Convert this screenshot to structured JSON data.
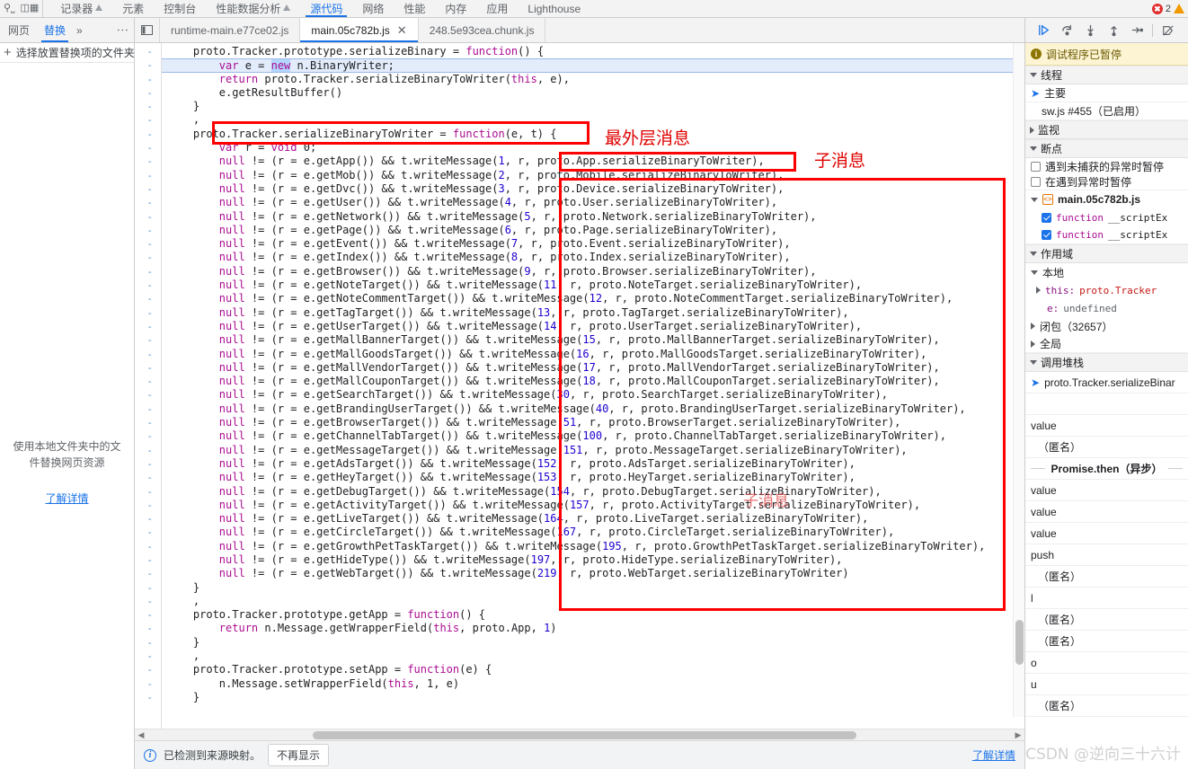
{
  "topbar": {
    "left_icons": [
      "cursor-select-icon",
      "device-toolbar-icon"
    ],
    "recorder_tab": "记录器",
    "panel_tabs": [
      {
        "label": "元素",
        "active": false,
        "warn": false
      },
      {
        "label": "控制台",
        "active": false,
        "warn": false
      },
      {
        "label": "性能数据分析",
        "active": false,
        "warn": true
      },
      {
        "label": "源代码",
        "active": true,
        "warn": false
      },
      {
        "label": "网络",
        "active": false,
        "warn": false
      },
      {
        "label": "性能",
        "active": false,
        "warn": false
      },
      {
        "label": "内存",
        "active": false,
        "warn": false
      },
      {
        "label": "应用",
        "active": false,
        "warn": false
      },
      {
        "label": "Lighthouse",
        "active": false,
        "warn": false
      }
    ],
    "error_count": "2"
  },
  "navigator": {
    "tabs": [
      {
        "label": "网页",
        "active": false
      },
      {
        "label": "替换",
        "active": true
      }
    ],
    "more_label": "»",
    "add_folder_label": "选择放置替换项的文件夹",
    "empty_message": "使用本地文件夹中的文件替换网页资源",
    "learn_more": "了解详情"
  },
  "editor": {
    "tabs": [
      {
        "label": "runtime-main.e77ce02.js",
        "active": false,
        "closable": false
      },
      {
        "label": "main.05c782b.js",
        "active": true,
        "closable": true
      },
      {
        "label": "248.5e93cea.chunk.js",
        "active": false,
        "closable": false
      }
    ],
    "code_lines": [
      "    proto.Tracker.prototype.serializeBinary = function() {",
      "        var e = new n.BinaryWriter;",
      "        return proto.Tracker.serializeBinaryToWriter(this, e),",
      "        e.getResultBuffer()",
      "    }",
      "    ,",
      "    proto.Tracker.serializeBinaryToWriter = function(e, t) {",
      "        var r = void 0;",
      "        null != (r = e.getApp()) && t.writeMessage(1, r, proto.App.serializeBinaryToWriter),",
      "        null != (r = e.getMob()) && t.writeMessage(2, r, proto.Mobile.serializeBinaryToWriter),",
      "        null != (r = e.getDvc()) && t.writeMessage(3, r, proto.Device.serializeBinaryToWriter),",
      "        null != (r = e.getUser()) && t.writeMessage(4, r, proto.User.serializeBinaryToWriter),",
      "        null != (r = e.getNetwork()) && t.writeMessage(5, r, proto.Network.serializeBinaryToWriter),",
      "        null != (r = e.getPage()) && t.writeMessage(6, r, proto.Page.serializeBinaryToWriter),",
      "        null != (r = e.getEvent()) && t.writeMessage(7, r, proto.Event.serializeBinaryToWriter),",
      "        null != (r = e.getIndex()) && t.writeMessage(8, r, proto.Index.serializeBinaryToWriter),",
      "        null != (r = e.getBrowser()) && t.writeMessage(9, r, proto.Browser.serializeBinaryToWriter),",
      "        null != (r = e.getNoteTarget()) && t.writeMessage(11, r, proto.NoteTarget.serializeBinaryToWriter),",
      "        null != (r = e.getNoteCommentTarget()) && t.writeMessage(12, r, proto.NoteCommentTarget.serializeBinaryToWriter),",
      "        null != (r = e.getTagTarget()) && t.writeMessage(13, r, proto.TagTarget.serializeBinaryToWriter),",
      "        null != (r = e.getUserTarget()) && t.writeMessage(14, r, proto.UserTarget.serializeBinaryToWriter),",
      "        null != (r = e.getMallBannerTarget()) && t.writeMessage(15, r, proto.MallBannerTarget.serializeBinaryToWriter),",
      "        null != (r = e.getMallGoodsTarget()) && t.writeMessage(16, r, proto.MallGoodsTarget.serializeBinaryToWriter),",
      "        null != (r = e.getMallVendorTarget()) && t.writeMessage(17, r, proto.MallVendorTarget.serializeBinaryToWriter),",
      "        null != (r = e.getMallCouponTarget()) && t.writeMessage(18, r, proto.MallCouponTarget.serializeBinaryToWriter),",
      "        null != (r = e.getSearchTarget()) && t.writeMessage(30, r, proto.SearchTarget.serializeBinaryToWriter),",
      "        null != (r = e.getBrandingUserTarget()) && t.writeMessage(40, r, proto.BrandingUserTarget.serializeBinaryToWriter),",
      "        null != (r = e.getBrowserTarget()) && t.writeMessage(51, r, proto.BrowserTarget.serializeBinaryToWriter),",
      "        null != (r = e.getChannelTabTarget()) && t.writeMessage(100, r, proto.ChannelTabTarget.serializeBinaryToWriter),",
      "        null != (r = e.getMessageTarget()) && t.writeMessage(151, r, proto.MessageTarget.serializeBinaryToWriter),",
      "        null != (r = e.getAdsTarget()) && t.writeMessage(152, r, proto.AdsTarget.serializeBinaryToWriter),",
      "        null != (r = e.getHeyTarget()) && t.writeMessage(153, r, proto.HeyTarget.serializeBinaryToWriter),",
      "        null != (r = e.getDebugTarget()) && t.writeMessage(154, r, proto.DebugTarget.serializeBinaryToWriter),",
      "        null != (r = e.getActivityTarget()) && t.writeMessage(157, r, proto.ActivityTarget.serializeBinaryToWriter),",
      "        null != (r = e.getLiveTarget()) && t.writeMessage(164, r, proto.LiveTarget.serializeBinaryToWriter),",
      "        null != (r = e.getCircleTarget()) && t.writeMessage(167, r, proto.CircleTarget.serializeBinaryToWriter),",
      "        null != (r = e.getGrowthPetTaskTarget()) && t.writeMessage(195, r, proto.GrowthPetTaskTarget.serializeBinaryToWriter),",
      "        null != (r = e.getHideType()) && t.writeMessage(197, r, proto.HideType.serializeBinaryToWriter),",
      "        null != (r = e.getWebTarget()) && t.writeMessage(219, r, proto.WebTarget.serializeBinaryToWriter)",
      "    }",
      "    ,",
      "    proto.Tracker.prototype.getApp = function() {",
      "        return n.Message.getWrapperField(this, proto.App, 1)",
      "    }",
      "    ,",
      "    proto.Tracker.prototype.setApp = function(e) {",
      "        n.Message.setWrapperField(this, 1, e)",
      "    }"
    ],
    "highlight_line_index": 1,
    "selected_token": "new"
  },
  "annotations": [
    {
      "id": "outer-message",
      "text": "最外层消息"
    },
    {
      "id": "sub-message",
      "text": "子消息"
    },
    {
      "id": "sub-message-faded",
      "text": "子消息"
    }
  ],
  "status_bar": {
    "icon": "info-icon",
    "message": "已检测到来源映射。",
    "dismiss_button": "不再显示",
    "learn_more": "了解详情"
  },
  "debugger": {
    "controls": [
      "resume-script-icon",
      "step-over-icon",
      "step-into-icon",
      "step-out-icon",
      "step-icon",
      "deactivate-breakpoints-icon"
    ],
    "paused_banner": "调试程序已暂停",
    "threads": {
      "title": "线程",
      "items": [
        {
          "label": "主要",
          "selected": true
        },
        {
          "label": "sw.js #455（已启用）",
          "selected": false
        }
      ]
    },
    "watch": {
      "title": "监视"
    },
    "breakpoints": {
      "title": "断点",
      "pause_uncaught": "遇到未捕获的异常时暂停",
      "pause_exceptions": "在遇到异常时暂停",
      "file": "main.05c782b.js",
      "entries": [
        {
          "prefix": "function",
          "label": "__scriptEx",
          "checked": true
        },
        {
          "prefix": "function",
          "label": "__scriptEx",
          "checked": true
        }
      ]
    },
    "scope": {
      "title": "作用域",
      "local_label": "本地",
      "locals": [
        {
          "key": "this:",
          "value": "proto.Tracker",
          "expandable": true
        },
        {
          "key": "e:",
          "value": "undefined",
          "expandable": false
        }
      ],
      "closure_label": "闭包（32657）",
      "global_label": "全局"
    },
    "call_stack": {
      "title": "调用堆栈",
      "frames": [
        {
          "label": "proto.Tracker.serializeBinar",
          "active": true,
          "async": false,
          "indent": 0
        },
        {
          "label": "",
          "active": false,
          "async": false,
          "indent": 0
        },
        {
          "label": "value",
          "active": false,
          "async": false,
          "indent": 0
        },
        {
          "label": "（匿名）",
          "active": false,
          "async": false,
          "indent": 1
        },
        {
          "label": "Promise.then（异步）",
          "active": false,
          "async": true,
          "indent": 0
        },
        {
          "label": "value",
          "active": false,
          "async": false,
          "indent": 0
        },
        {
          "label": "value",
          "active": false,
          "async": false,
          "indent": 0
        },
        {
          "label": "value",
          "active": false,
          "async": false,
          "indent": 0
        },
        {
          "label": "push",
          "active": false,
          "async": false,
          "indent": 0
        },
        {
          "label": "（匿名）",
          "active": false,
          "async": false,
          "indent": 1
        },
        {
          "label": "l",
          "active": false,
          "async": false,
          "indent": 0
        },
        {
          "label": "（匿名）",
          "active": false,
          "async": false,
          "indent": 1
        },
        {
          "label": "（匿名）",
          "active": false,
          "async": false,
          "indent": 1
        },
        {
          "label": "o",
          "active": false,
          "async": false,
          "indent": 0
        },
        {
          "label": "u",
          "active": false,
          "async": false,
          "indent": 0
        },
        {
          "label": "（匿名）",
          "active": false,
          "async": false,
          "indent": 1
        }
      ]
    }
  },
  "watermark": "CSDN @逆向三十六计",
  "colors": {
    "accent": "#1a73e8",
    "annotation_red": "#ff0000",
    "paused_bg": "#fdf4d4",
    "keyword": "#aa0d91",
    "number": "#1c00cf"
  }
}
